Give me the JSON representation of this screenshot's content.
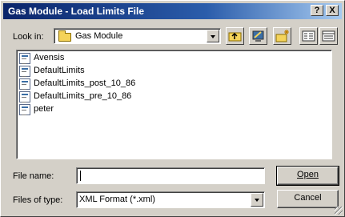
{
  "window": {
    "title": "Gas Module - Load Limits File",
    "help_label": "?",
    "close_label": "X"
  },
  "lookin": {
    "label": "Look in:",
    "value": "Gas Module"
  },
  "files": [
    {
      "name": "Avensis"
    },
    {
      "name": "DefaultLimits"
    },
    {
      "name": "DefaultLimits_post_10_86"
    },
    {
      "name": "DefaultLimits_pre_10_86"
    },
    {
      "name": "peter"
    }
  ],
  "filename": {
    "label": "File name:",
    "value": ""
  },
  "filetype": {
    "label": "Files of type:",
    "value": "XML Format (*.xml)"
  },
  "buttons": {
    "open": "Open",
    "cancel": "Cancel"
  },
  "colors": {
    "title_bar_start": "#0a246a",
    "title_bar_end": "#a6caf0",
    "dialog_face": "#d4d0c8"
  }
}
